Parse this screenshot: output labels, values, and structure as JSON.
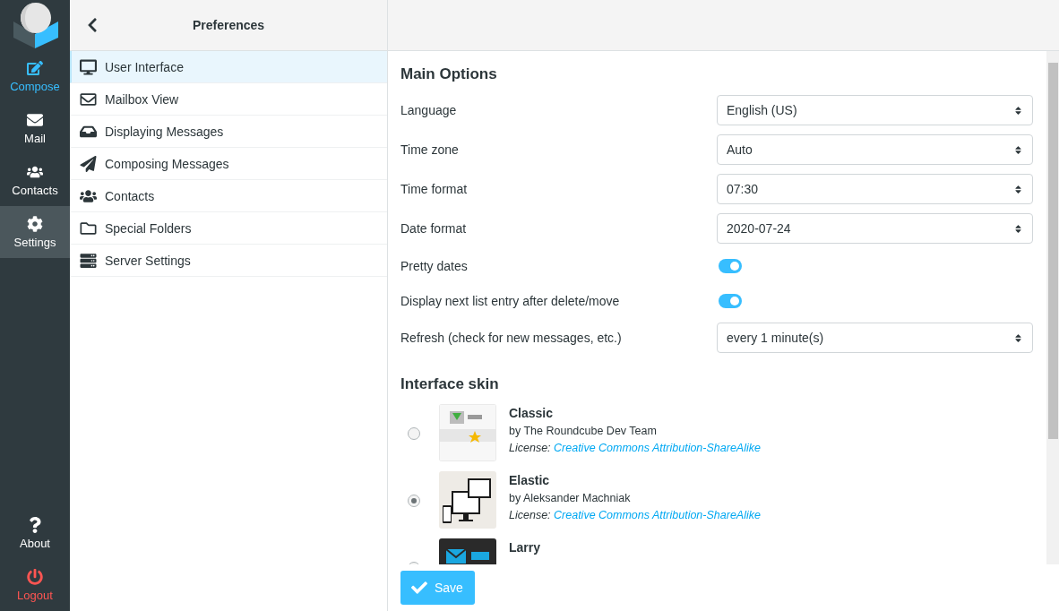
{
  "nav": {
    "items": [
      {
        "label": "Compose",
        "kind": "compose",
        "selected": false
      },
      {
        "label": "Mail",
        "kind": "mail",
        "selected": false
      },
      {
        "label": "Contacts",
        "kind": "contacts",
        "selected": false
      },
      {
        "label": "Settings",
        "kind": "settings",
        "selected": true
      }
    ],
    "bottom": [
      {
        "label": "About",
        "kind": "about"
      },
      {
        "label": "Logout",
        "kind": "logout"
      }
    ]
  },
  "sections_panel": {
    "title": "Preferences",
    "items": [
      {
        "label": "User Interface",
        "kind": "desktop",
        "selected": true
      },
      {
        "label": "Mailbox View",
        "kind": "envelope",
        "selected": false
      },
      {
        "label": "Displaying Messages",
        "kind": "inbox",
        "selected": false
      },
      {
        "label": "Composing Messages",
        "kind": "plane",
        "selected": false
      },
      {
        "label": "Contacts",
        "kind": "users",
        "selected": false
      },
      {
        "label": "Special Folders",
        "kind": "folder",
        "selected": false
      },
      {
        "label": "Server Settings",
        "kind": "server",
        "selected": false
      }
    ]
  },
  "main": {
    "title": "Main Options",
    "rows": [
      {
        "label": "Language",
        "kind": "select",
        "value": "English (US)"
      },
      {
        "label": "Time zone",
        "kind": "select",
        "value": "Auto"
      },
      {
        "label": "Time format",
        "kind": "select",
        "value": "07:30"
      },
      {
        "label": "Date format",
        "kind": "select",
        "value": "2020-07-24"
      },
      {
        "label": "Pretty dates",
        "kind": "toggle",
        "on": true
      },
      {
        "label": "Display next list entry after delete/move",
        "kind": "toggle",
        "on": true
      },
      {
        "label": "Refresh (check for new messages, etc.)",
        "kind": "select",
        "value": "every 1 minute(s)"
      }
    ],
    "skins": {
      "title": "Interface skin",
      "items": [
        {
          "name": "Classic",
          "author": "by The Roundcube Dev Team",
          "license_label": "License:",
          "license": "Creative Commons Attribution-ShareAlike",
          "selected": false,
          "kind": "classic"
        },
        {
          "name": "Elastic",
          "author": "by Aleksander Machniak",
          "license_label": "License:",
          "license": "Creative Commons Attribution-ShareAlike",
          "selected": true,
          "kind": "elastic"
        },
        {
          "name": "Larry",
          "kind": "larry"
        }
      ]
    },
    "save": "Save"
  }
}
